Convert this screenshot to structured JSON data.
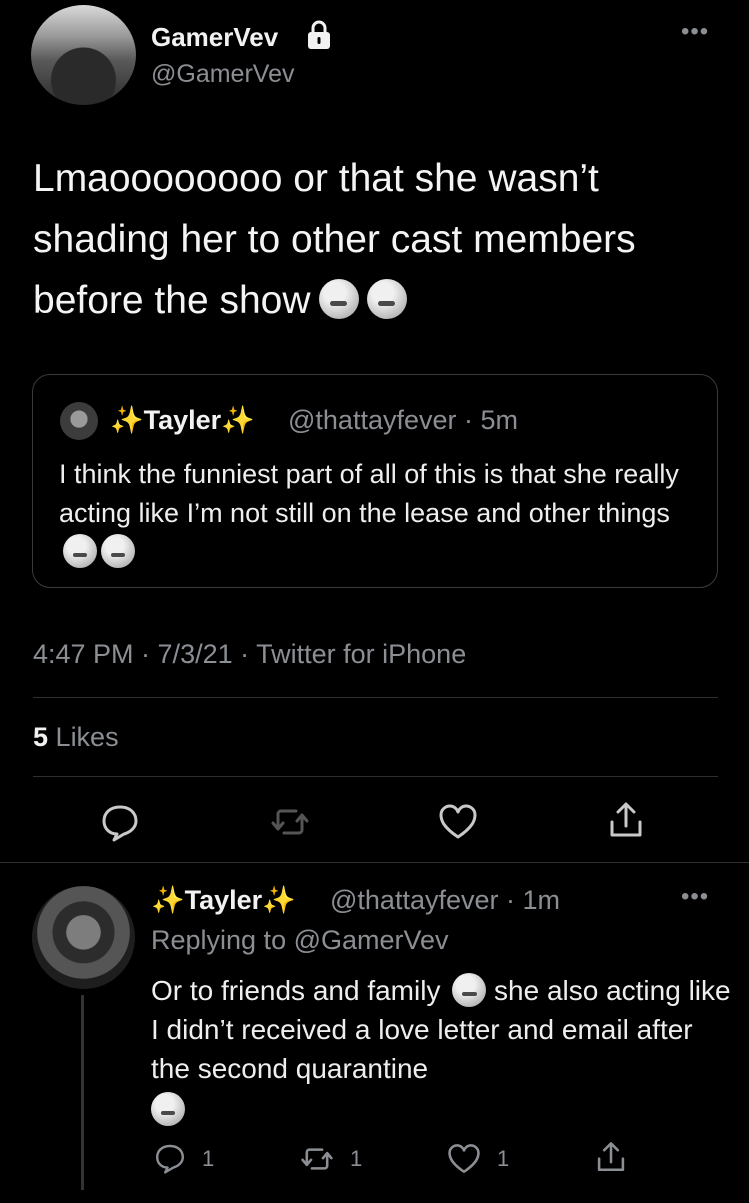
{
  "tweet": {
    "author_name": "GamerVev",
    "author_handle": "@GamerVev",
    "text": "Lmaoooooooo or that she wasn’t shading her to other cast members before the show",
    "timestamp": "4:47 PM · 7/3/21 · Twitter for iPhone",
    "likes_count": "5",
    "likes_label": "Likes",
    "more": "•••"
  },
  "quoted": {
    "name": "Tayler",
    "sparkle": "✨",
    "handle_time": "@thattayfever · 5m",
    "text": "I think the funniest part of all of this is that she really acting like I’m not still on the lease and other things"
  },
  "reply": {
    "name": "Tayler",
    "sparkle": "✨",
    "handle_time": "@thattayfever · 1m",
    "replying_to": "Replying to @GamerVev",
    "text_part1": "Or to friends and family",
    "text_part2": "she also acting like I didn’t received a love letter and email after the second quarantine",
    "reply_count": "1",
    "retweet_count": "1",
    "like_count": "1",
    "more": "•••"
  },
  "icons": {
    "lock": "lock-icon",
    "reply": "reply-icon",
    "retweet": "retweet-icon",
    "like": "heart-icon",
    "share": "share-icon"
  }
}
